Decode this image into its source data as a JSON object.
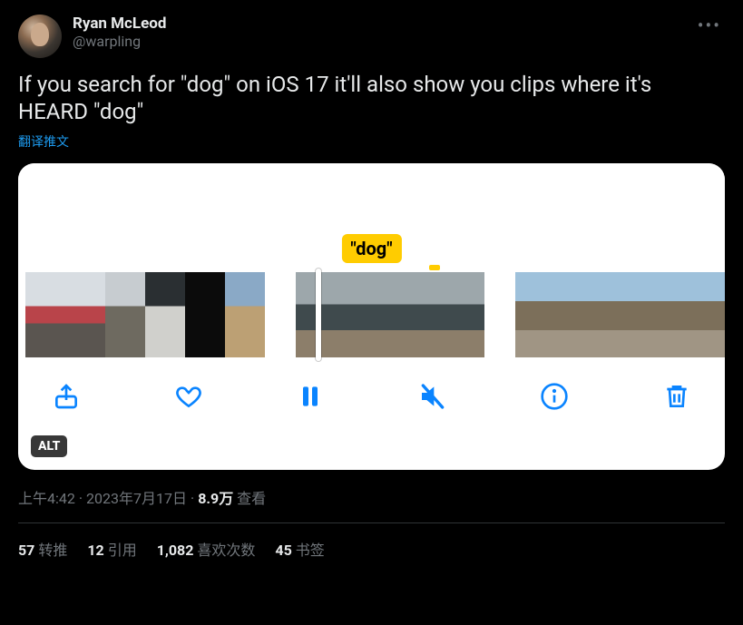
{
  "author": {
    "display_name": "Ryan McLeod",
    "handle": "@warpling"
  },
  "tweet_text": "If you search for \"dog\" on iOS 17 it'll also show you clips where it's HEARD \"dog\"",
  "translate_label": "翻译推文",
  "media": {
    "chip_text": "\"dog\"",
    "alt_badge": "ALT"
  },
  "meta": {
    "time": "上午4:42",
    "date": "2023年7月17日",
    "views_count": "8.9万",
    "views_label": "查看"
  },
  "stats": {
    "retweet": {
      "count": "57",
      "label": "转推"
    },
    "quote": {
      "count": "12",
      "label": "引用"
    },
    "like": {
      "count": "1,082",
      "label": "喜欢次数"
    },
    "bookmark": {
      "count": "45",
      "label": "书签"
    }
  }
}
